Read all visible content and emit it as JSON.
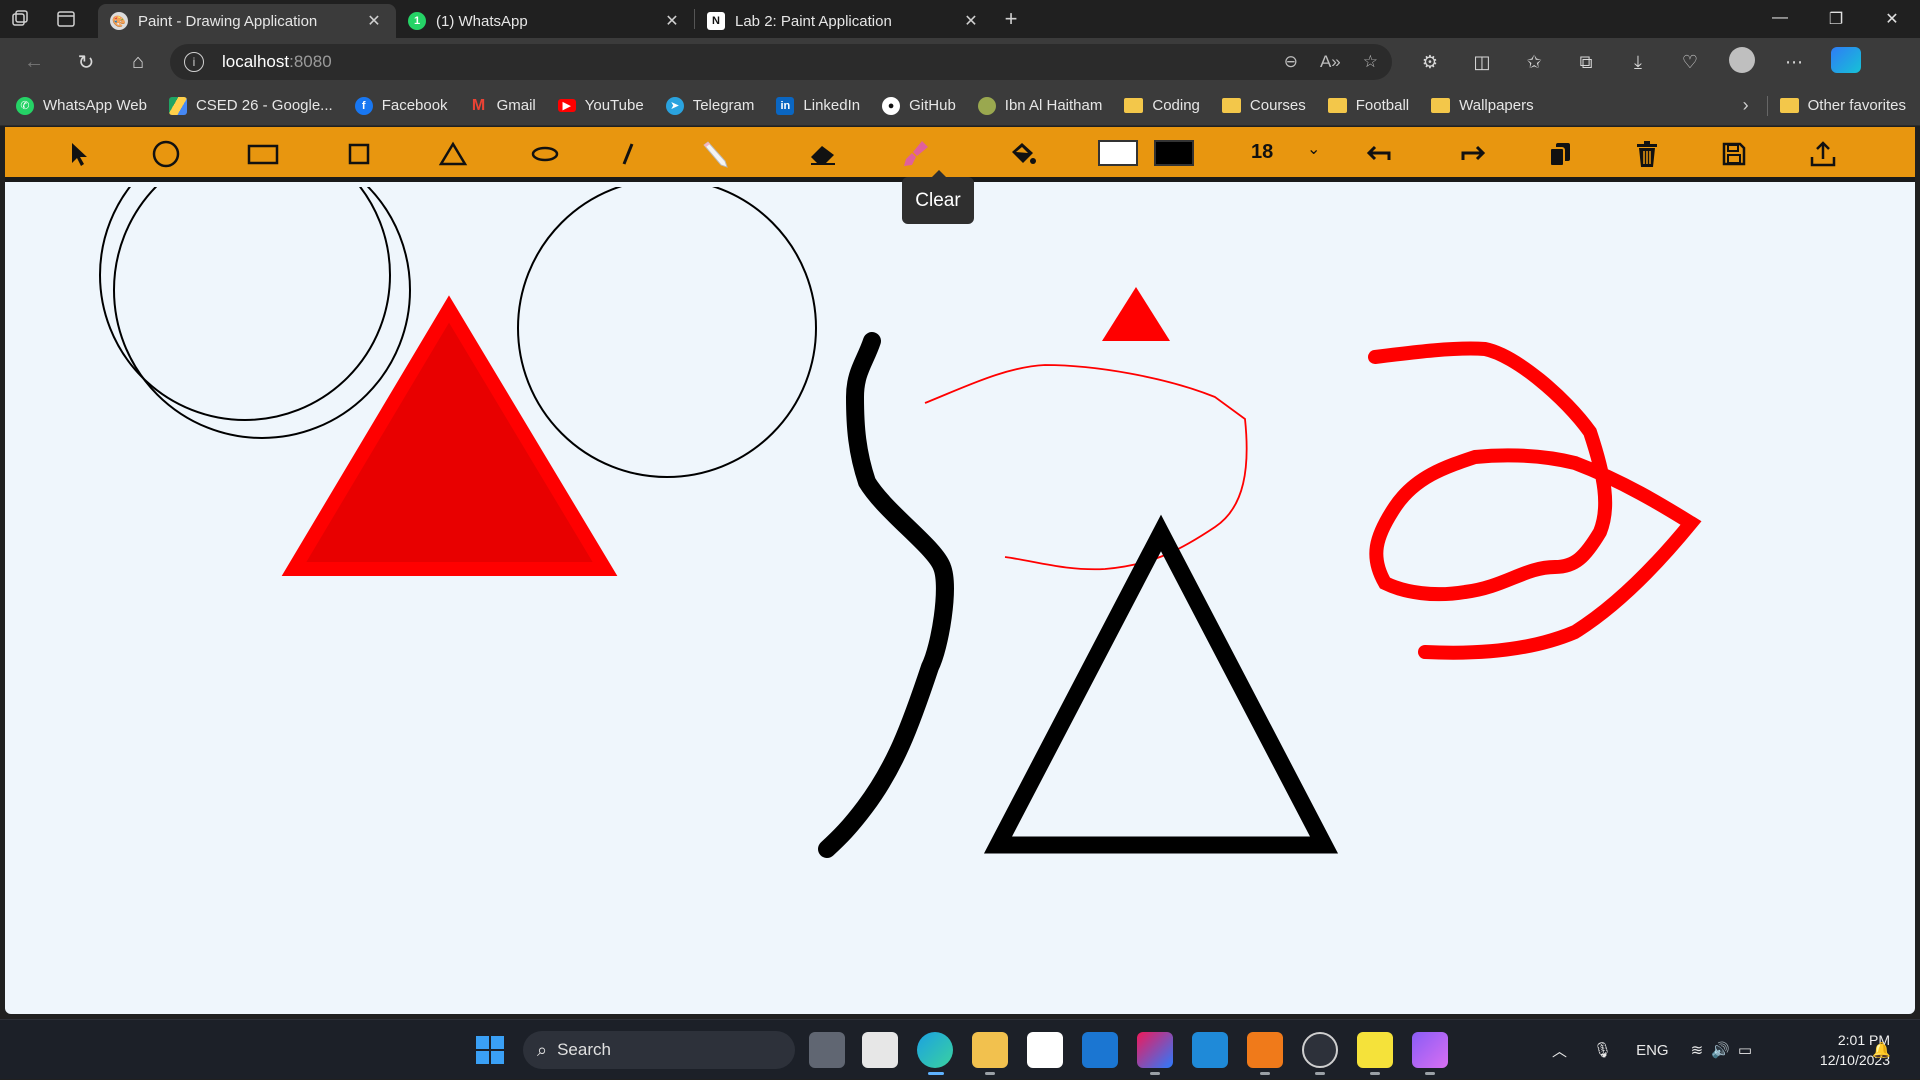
{
  "browser": {
    "tabs": [
      {
        "title": "Paint - Drawing Application",
        "active": true,
        "icon": "paint-palette-icon"
      },
      {
        "title": "(1) WhatsApp",
        "active": false,
        "icon": "whatsapp-icon",
        "badge": "1"
      },
      {
        "title": "Lab 2: Paint Application",
        "active": false,
        "icon": "notion-icon"
      }
    ],
    "address": {
      "host": "localhost",
      "port": ":8080"
    },
    "bookmarks": [
      {
        "label": "WhatsApp Web",
        "icon": "whatsapp-icon",
        "color": "#25d366"
      },
      {
        "label": "CSED 26 - Google...",
        "icon": "google-drive-icon",
        "color": "#1fa463"
      },
      {
        "label": "Facebook",
        "icon": "facebook-icon",
        "color": "#1877f2"
      },
      {
        "label": "Gmail",
        "icon": "gmail-icon",
        "color": "#ea4335"
      },
      {
        "label": "YouTube",
        "icon": "youtube-icon",
        "color": "#ff0000"
      },
      {
        "label": "Telegram",
        "icon": "telegram-icon",
        "color": "#2aa3df"
      },
      {
        "label": "LinkedIn",
        "icon": "linkedin-icon",
        "color": "#0a66c2"
      },
      {
        "label": "GitHub",
        "icon": "github-icon",
        "color": "#ffffff"
      },
      {
        "label": "Ibn Al Haitham",
        "icon": "site-icon",
        "color": "#9aa84f"
      },
      {
        "label": "Coding",
        "icon": "folder-icon"
      },
      {
        "label": "Courses",
        "icon": "folder-icon"
      },
      {
        "label": "Football",
        "icon": "folder-icon"
      },
      {
        "label": "Wallpapers",
        "icon": "folder-icon"
      }
    ],
    "other_favorites": "Other favorites"
  },
  "app": {
    "toolbar": {
      "tools": [
        "select-tool",
        "circle-tool",
        "rectangle-tool",
        "square-tool",
        "triangle-tool",
        "ellipse-tool",
        "line-tool",
        "pencil-tool",
        "eraser-tool",
        "clear-tool",
        "fill-tool"
      ],
      "fill_color": "#ffffff",
      "stroke_color": "#000000",
      "stroke_size": "18",
      "actions": [
        "undo",
        "redo",
        "copy",
        "delete",
        "save",
        "upload"
      ],
      "accent": "#e8960f"
    },
    "tooltip": "Clear"
  },
  "taskbar": {
    "search_placeholder": "Search",
    "language": "ENG",
    "time": "2:01 PM",
    "date": "12/10/2023"
  }
}
